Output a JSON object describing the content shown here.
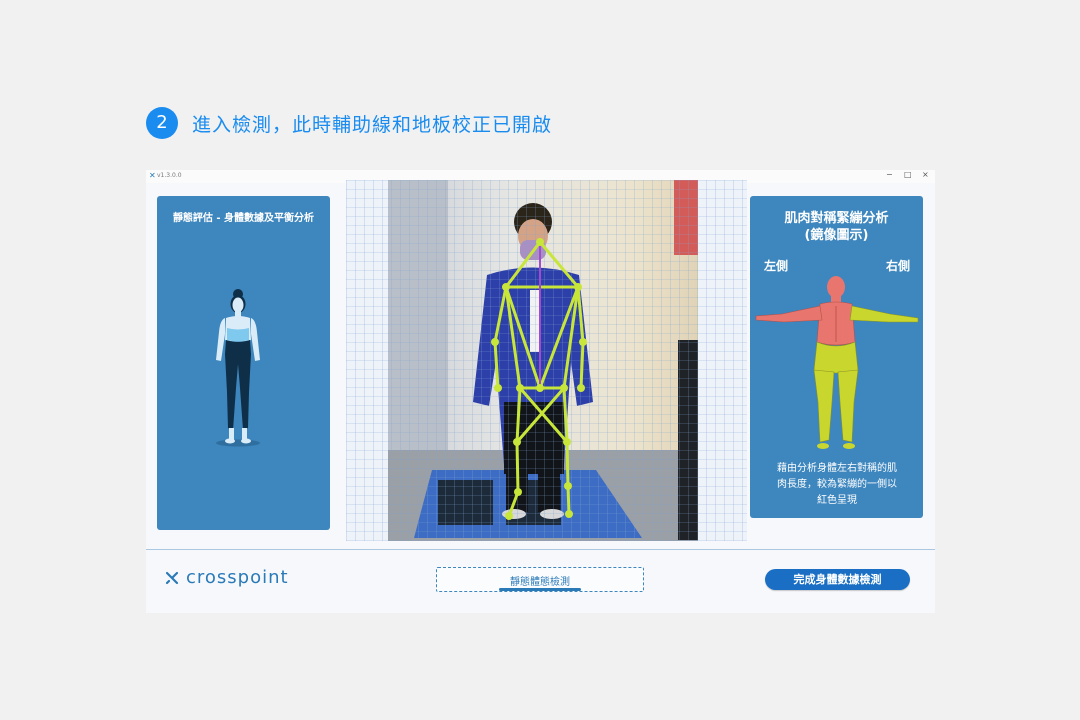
{
  "step": {
    "number": "2",
    "text": "進入檢測，此時輔助線和地板校正已開啟"
  },
  "window": {
    "version": "v1.3.0.0",
    "controls": {
      "minimize": "−",
      "maximize": "□",
      "close": "×"
    }
  },
  "left_panel": {
    "title": "靜態評估 - 身體數據及平衡分析"
  },
  "right_panel": {
    "title_line1": "肌肉對稱緊繃分析",
    "title_line2": "(鏡像圖示)",
    "left_label": "左側",
    "right_label": "右側",
    "desc_line1": "藉由分析身體左右對稱的肌",
    "desc_line2": "肉長度，較為緊繃的一側以",
    "desc_line3": "紅色呈現"
  },
  "footer": {
    "brand": "crosspoint",
    "status": "靜態體態檢測",
    "finish_button": "完成身體數據檢測"
  },
  "colors": {
    "accent": "#1a8cf0",
    "panel_blue": "#3d86be",
    "button_blue": "#1a6fc4",
    "skeleton": "#c8e63a",
    "tight_muscle": "#e8766f",
    "normal_muscle": "#c9d62e"
  },
  "icons": {
    "logo": "crosspoint-logo-icon"
  }
}
